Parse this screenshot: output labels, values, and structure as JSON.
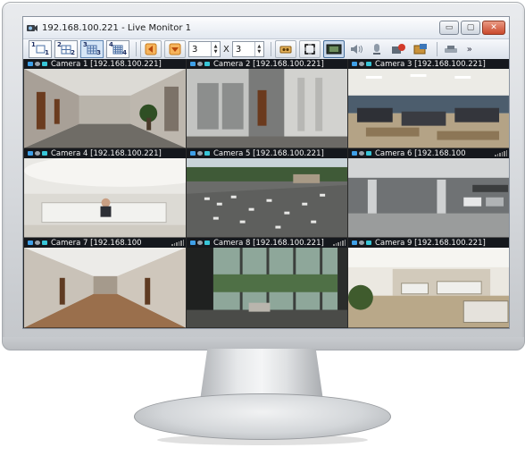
{
  "window": {
    "title": "192.168.100.221 - Live Monitor 1",
    "buttons": {
      "minimize": "▭",
      "maximize": "▢",
      "close": "✕"
    }
  },
  "toolbar": {
    "layouts": [
      {
        "a": "1",
        "b": "1"
      },
      {
        "a": "2",
        "b": "2"
      },
      {
        "a": "3",
        "b": "3"
      },
      {
        "a": "4",
        "b": "4"
      }
    ],
    "rows_value": "3",
    "separator": "X",
    "cols_value": "3",
    "more": "»"
  },
  "cameras": [
    {
      "label": "Camera 1 [192.168.100.221]",
      "scene": "hallway"
    },
    {
      "label": "Camera 2 [192.168.100.221]",
      "scene": "elevator-lobby"
    },
    {
      "label": "Camera 3 [192.168.100.221]",
      "scene": "open-office"
    },
    {
      "label": "Camera 4 [192.168.100.221]",
      "scene": "reception"
    },
    {
      "label": "Camera 5 [192.168.100.221]",
      "scene": "parking-lot-aerial"
    },
    {
      "label": "Camera 6 [192.168.100",
      "scene": "parking-garage"
    },
    {
      "label": "Camera 7 [192.168.100",
      "scene": "corridor"
    },
    {
      "label": "Camera 8 [192.168.100.221]",
      "scene": "glass-lobby"
    },
    {
      "label": "Camera 9 [192.168.100.221]",
      "scene": "office-cubicles"
    }
  ],
  "colors": {
    "camera_bar": "#15181d",
    "status_blue": "#3fa0e8",
    "status_gray": "#9aa2ab",
    "status_cyan": "#38c6d8",
    "close_red": "#c9492c"
  }
}
